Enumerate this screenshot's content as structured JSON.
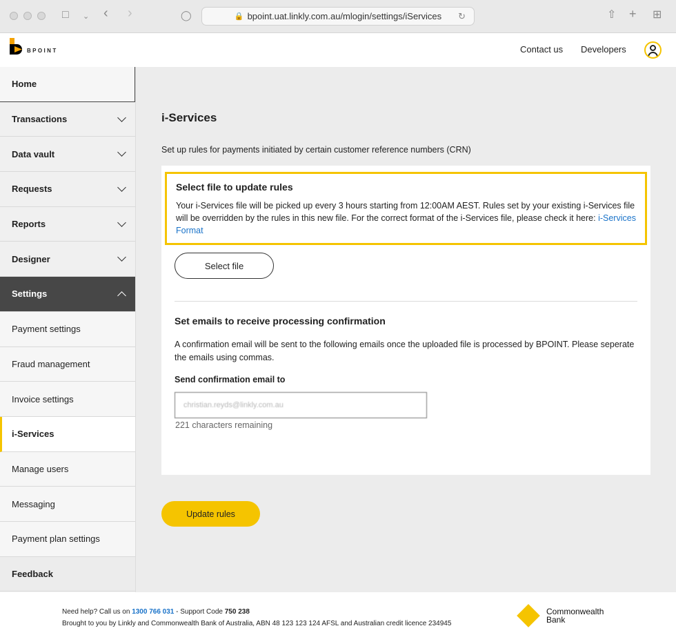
{
  "browser": {
    "url": "bpoint.uat.linkly.com.au/mlogin/settings/iServices"
  },
  "header": {
    "logo_text": "BPOINT",
    "links": [
      "Contact us",
      "Developers"
    ]
  },
  "sidebar": {
    "items": [
      {
        "label": "Home"
      },
      {
        "label": "Transactions"
      },
      {
        "label": "Data vault"
      },
      {
        "label": "Requests"
      },
      {
        "label": "Reports"
      },
      {
        "label": "Designer"
      },
      {
        "label": "Settings"
      },
      {
        "label": "Payment settings"
      },
      {
        "label": "Fraud management"
      },
      {
        "label": "Invoice settings"
      },
      {
        "label": "i-Services"
      },
      {
        "label": "Manage users"
      },
      {
        "label": "Messaging"
      },
      {
        "label": "Payment plan settings"
      },
      {
        "label": "Feedback"
      }
    ]
  },
  "main": {
    "title": "i-Services",
    "intro": "Set up rules for payments initiated by certain customer reference numbers (CRN)",
    "file_section": {
      "title": "Select file to update rules",
      "text": "Your i-Services file will be picked up every 3 hours starting from 12:00AM AEST. Rules set by your existing i-Services file will be overridden by the rules in this new file. For the correct format of the i-Services file, please check it here: ",
      "link": "i-Services Format",
      "button": "Select file"
    },
    "email_section": {
      "title": "Set emails to receive processing confirmation",
      "text": "A confirmation email will be sent to the following emails once the uploaded file is processed by BPOINT. Please seperate the emails using commas.",
      "label": "Send confirmation email to",
      "value": "christian.reyds@linkly.com.au",
      "remaining": "221 characters remaining"
    },
    "update_button": "Update rules"
  },
  "footer": {
    "help_prefix": "Need help? Call us on ",
    "phone": "1300 766 031",
    "support_prefix": " - Support Code ",
    "support_code": "750 238",
    "legal": "Brought to you by Linkly and Commonwealth Bank of Australia, ABN 48 123 123 124 AFSL and Australian credit licence 234945",
    "bank_line1": "Commonwealth",
    "bank_line2": "Bank"
  }
}
